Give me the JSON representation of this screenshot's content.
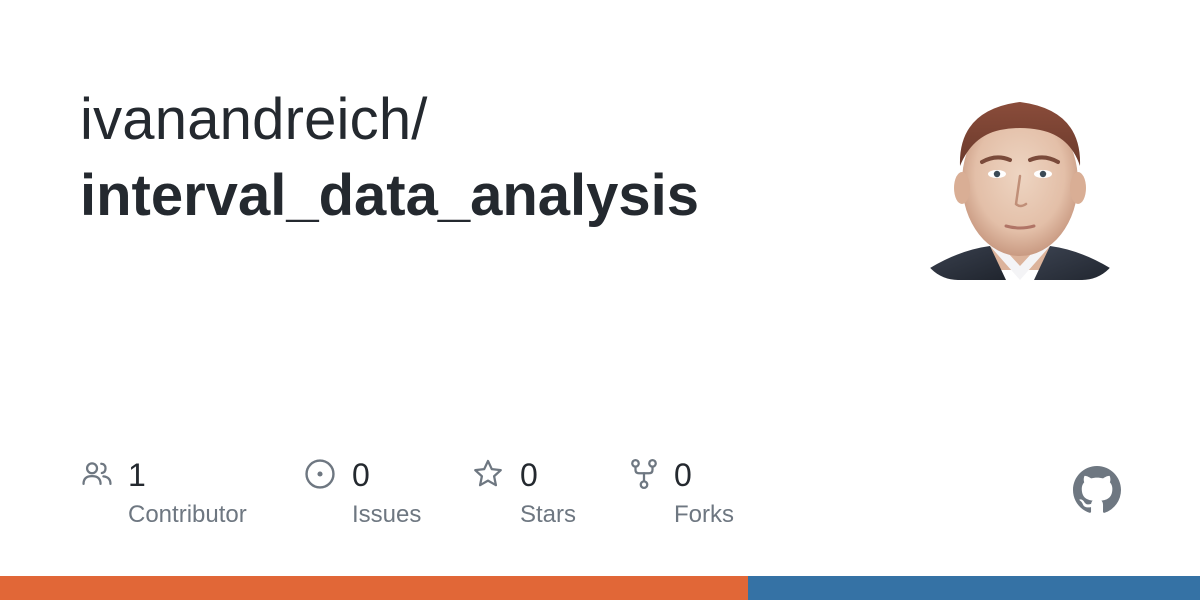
{
  "repository": {
    "owner": "ivanandreich/",
    "name": "interval_data_analysis"
  },
  "avatar": {
    "description_icon": "user-avatar-photo"
  },
  "stats": [
    {
      "icon": "people-icon",
      "count": "1",
      "label": "Contributor"
    },
    {
      "icon": "issue-opened-icon",
      "count": "0",
      "label": "Issues"
    },
    {
      "icon": "star-icon",
      "count": "0",
      "label": "Stars"
    },
    {
      "icon": "repo-forked-icon",
      "count": "0",
      "label": "Forks"
    }
  ],
  "brand": {
    "icon": "github-mark-icon",
    "color": "#6e7781"
  },
  "language_bar": {
    "segments": [
      {
        "color": "#e16737",
        "fraction": 0.623
      },
      {
        "color": "#3572a5",
        "fraction": 0.377
      }
    ]
  },
  "colors": {
    "text_primary": "#24292f",
    "text_secondary": "#6e7781",
    "icon": "#6e7781"
  }
}
